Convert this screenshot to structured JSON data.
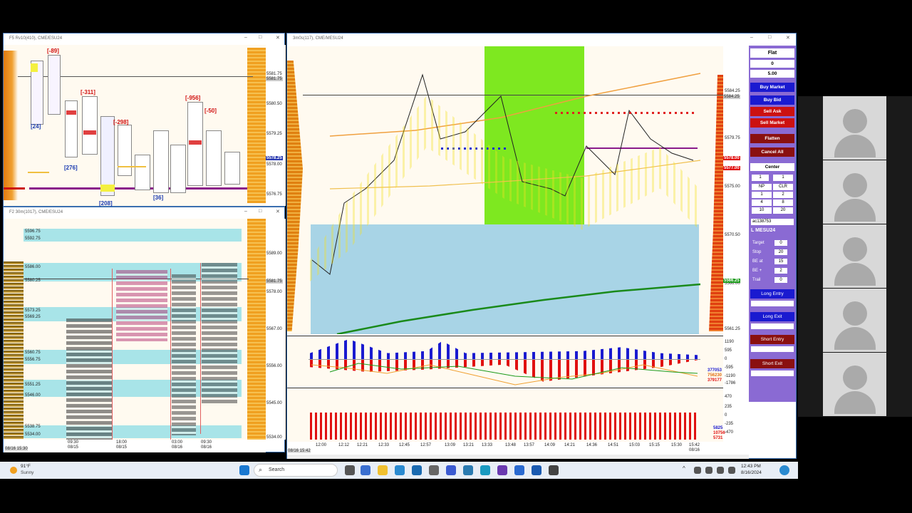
{
  "top_left_window": {
    "title": "F5 Rv10(410), CME/ESU24",
    "price_ticks": [
      "5581.75",
      "5580.50",
      "5579.25",
      "5578.00",
      "5576.75"
    ],
    "current_price": "5578.25",
    "last_price": "5581.75",
    "delta_labels": [
      "[-89]",
      "[-311]",
      "[-298]",
      "[-956]",
      "[-50]",
      "[24]",
      "[276]",
      "[208]",
      "[36]"
    ]
  },
  "bottom_left_window": {
    "title": "F2 30m(1017), CME/ESU24",
    "level_labels": [
      "5596.75",
      "5592.75",
      "5586.00",
      "5580.25",
      "5573.25",
      "5569.25",
      "5560.75",
      "5556.75",
      "5551.25",
      "5546.00",
      "5538.75",
      "5534.00"
    ],
    "price_ticks": [
      "5589.00",
      "5578.00",
      "5567.00",
      "5556.00",
      "5545.00",
      "5534.00"
    ],
    "current_price": "5581.75",
    "time_ticks": [
      {
        "time": "09:30",
        "date": "08/15"
      },
      {
        "time": "18:00",
        "date": "08/15"
      },
      {
        "time": "03:00",
        "date": "08/16"
      },
      {
        "time": "09:30",
        "date": "08/16"
      }
    ],
    "corner_label": "08/16 15:30"
  },
  "main_window": {
    "title": "3m0s(117), CME/MESU24",
    "price_ticks": [
      "5584.25",
      "5579.75",
      "5575.00",
      "5570.50",
      "5566.00",
      "5561.25"
    ],
    "price_badges": {
      "top": "5584.25",
      "current": "5578.00",
      "bid": "5577.00",
      "green": "5566.25"
    },
    "time_ticks": [
      "12:00",
      "12:12",
      "12:21",
      "12:33",
      "12:45",
      "12:57",
      "13:09",
      "13:21",
      "13:33",
      "13:48",
      "13:57",
      "14:09",
      "14:21",
      "14:36",
      "14:51",
      "15:03",
      "15:15",
      "15:30",
      "15:42"
    ],
    "date_label": "08/16",
    "corner_label": "08/16 15:42",
    "indicator_ticks": [
      "1190",
      "595",
      "0",
      "-595",
      "-1190",
      "-1786"
    ],
    "indicator_values": [
      "377053",
      "756230",
      "379177"
    ],
    "volume_ticks": [
      "470",
      "235",
      "0",
      "-235",
      "-470"
    ],
    "volume_values": [
      "5825",
      "10756",
      "5731"
    ]
  },
  "order_panel": {
    "position": "Flat",
    "quantity": "0",
    "size": "5.00",
    "buy_market": "Buy Market",
    "buy_bid": "Buy Bid",
    "sell_ask": "Sell Ask",
    "sell_market": "Sell Market",
    "flatten": "Flatten",
    "cancel_all": "Cancel All",
    "center": "Center",
    "qty_left": "1",
    "qty_right": "1",
    "grid": [
      [
        "NP",
        "CLR"
      ],
      [
        "1",
        "2"
      ],
      [
        "4",
        "8"
      ],
      [
        "10",
        "20"
      ]
    ],
    "account": "ac138753",
    "instrument": "L MESU24",
    "target_label": "Target",
    "target_value": "0",
    "stop_label": "Stop",
    "stop_value": "20",
    "be_at_label": "BE at",
    "be_at_value": "15",
    "be_plus_label": "BE +",
    "be_plus_value": "2",
    "trail_label": "Trail",
    "trail_value": "0",
    "long_entry": "Long Entry",
    "long_exit": "Long Exit",
    "short_entry": "Short Entry",
    "short_exit": "Short Exit",
    "colors": {
      "panel": "#8a6ad3",
      "buy": "#1a1ad0",
      "sell": "#cc1111"
    }
  },
  "taskbar": {
    "temperature": "91°F",
    "weather": "Sunny",
    "search_placeholder": "Search",
    "time": "12:43 PM",
    "date": "8/16/2024"
  }
}
